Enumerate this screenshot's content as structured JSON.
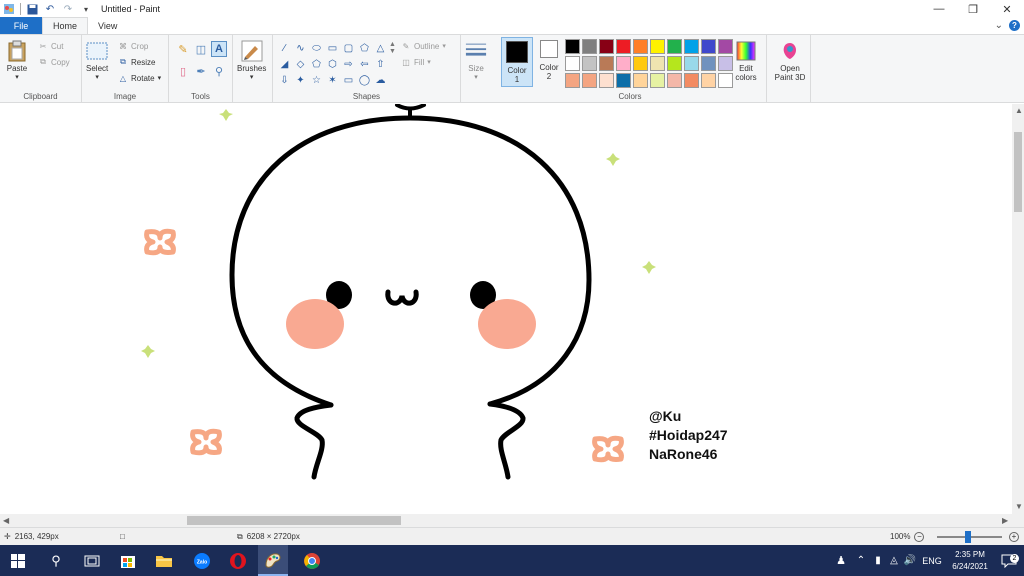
{
  "window": {
    "title": "Untitled - Paint"
  },
  "tabs": {
    "file": "File",
    "home": "Home",
    "view": "View"
  },
  "ribbon": {
    "clipboard": {
      "label": "Clipboard",
      "paste": "Paste",
      "cut": "Cut",
      "copy": "Copy"
    },
    "image": {
      "label": "Image",
      "select": "Select",
      "crop": "Crop",
      "resize": "Resize",
      "rotate": "Rotate"
    },
    "tools": {
      "label": "Tools"
    },
    "brushes": {
      "label": "Brushes"
    },
    "shapes": {
      "label": "Shapes",
      "outline": "Outline",
      "fill": "Fill"
    },
    "size": {
      "label": "Size"
    },
    "color1": {
      "label": "Color",
      "num": "1",
      "color": "#000000"
    },
    "color2": {
      "label": "Color",
      "num": "2",
      "color": "#ffffff"
    },
    "colors": {
      "label": "Colors",
      "swatches": [
        "#000000",
        "#7f7f7f",
        "#880015",
        "#ed1c24",
        "#ff7f27",
        "#fff200",
        "#22b14c",
        "#00a2e8",
        "#3f48cc",
        "#a349a4",
        "#ffffff",
        "#c3c3c3",
        "#b97a57",
        "#ffaec9",
        "#ffc90e",
        "#efe4b0",
        "#b5e61d",
        "#99d9ea",
        "#7092be",
        "#c8bfe7",
        "#f4a582",
        "#f4a582",
        "#fde0d0",
        "#0c6ea8",
        "#ffd49a",
        "#e6f2a3",
        "#f4b7a8",
        "#f38b62",
        "#ffd3a5",
        "#ffffff"
      ]
    },
    "edit_colors": {
      "line1": "Edit",
      "line2": "colors"
    },
    "paint3d": {
      "line1": "Open",
      "line2": "Paint 3D"
    }
  },
  "canvas": {
    "text_lines": [
      "@Ku",
      "#Hoidap247",
      "NaRone46"
    ]
  },
  "status": {
    "cursor_pos": "2163, 429px",
    "image_size": "6208 × 2720px",
    "zoom": "100%"
  },
  "taskbar": {
    "time": "2:35 PM",
    "date": "6/24/2021",
    "lang": "ENG",
    "notifications": "2"
  }
}
